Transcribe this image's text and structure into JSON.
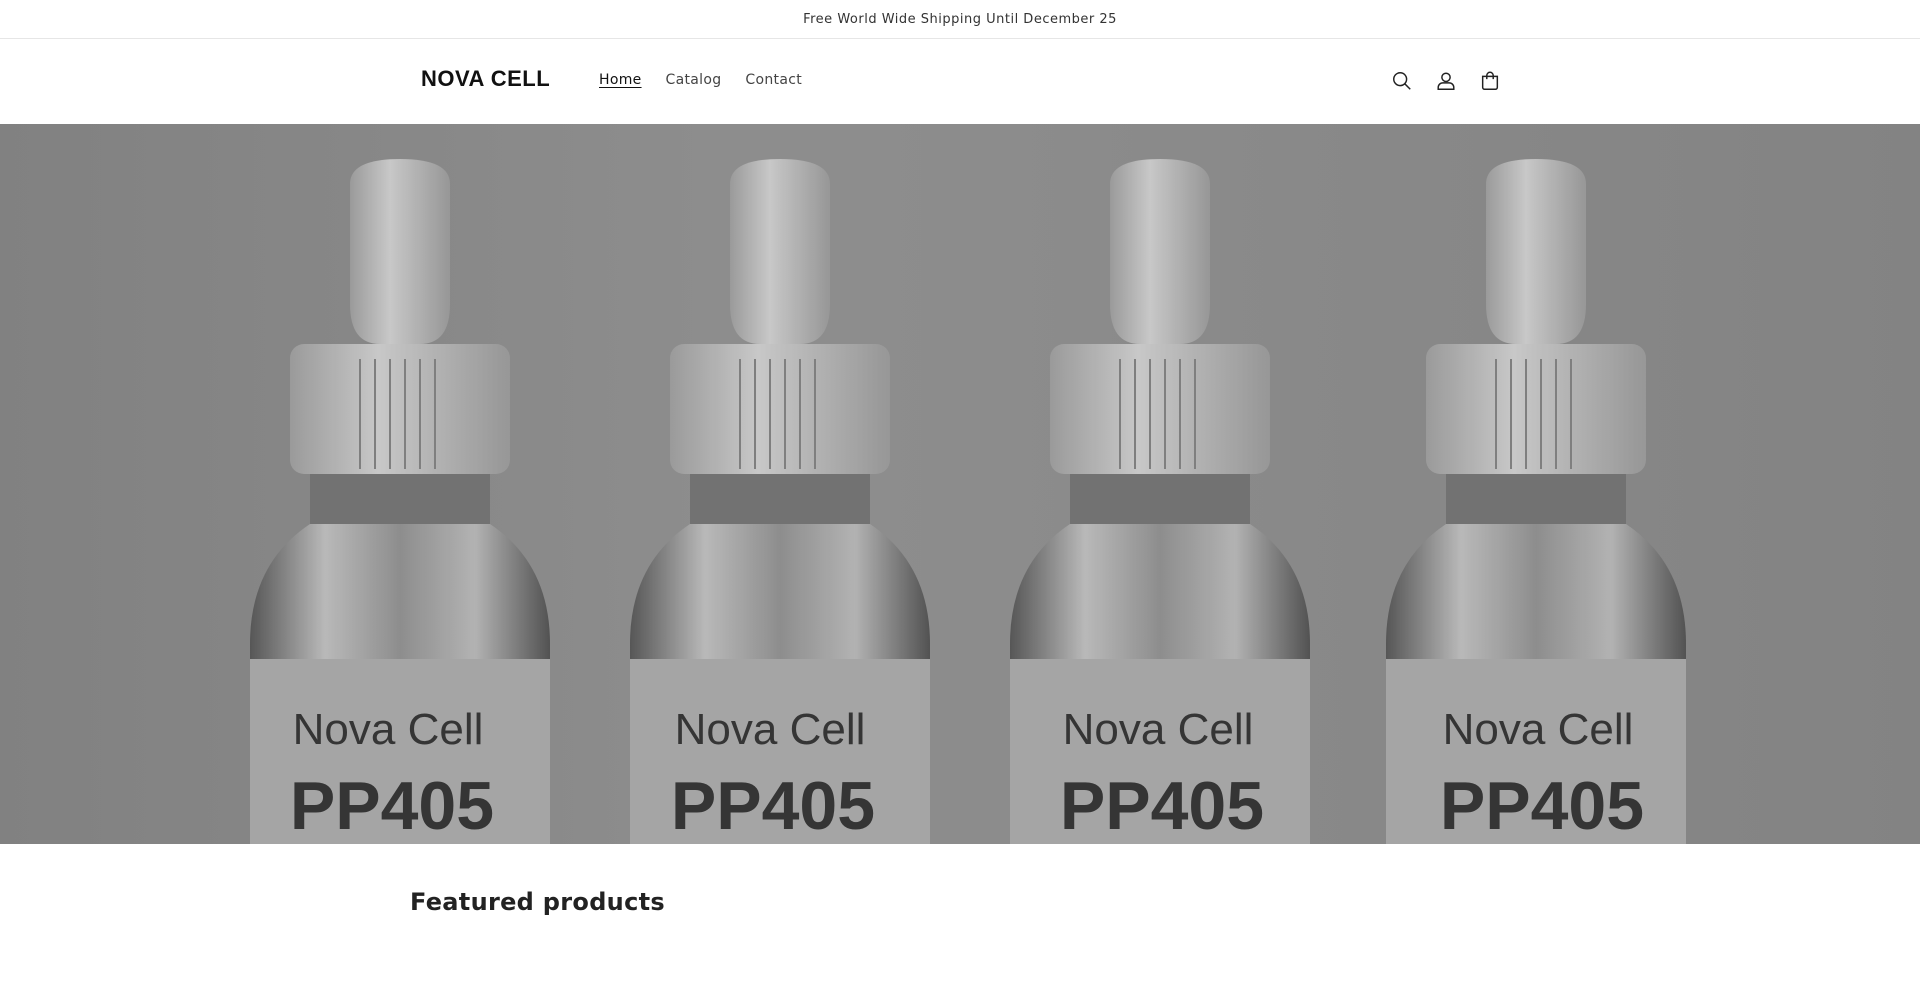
{
  "announcement": {
    "text": "Free World Wide Shipping Until December 25"
  },
  "header": {
    "logo": "NOVA CELL",
    "nav": [
      {
        "label": "Home",
        "active": true
      },
      {
        "label": "Catalog",
        "active": false
      },
      {
        "label": "Contact",
        "active": false
      }
    ],
    "icons": [
      "search-icon",
      "account-icon",
      "cart-icon"
    ]
  },
  "hero": {
    "bottle_brand": "Nova Cell",
    "bottle_product": "PP405",
    "bottle_count": 4
  },
  "featured": {
    "heading": "Featured products"
  }
}
